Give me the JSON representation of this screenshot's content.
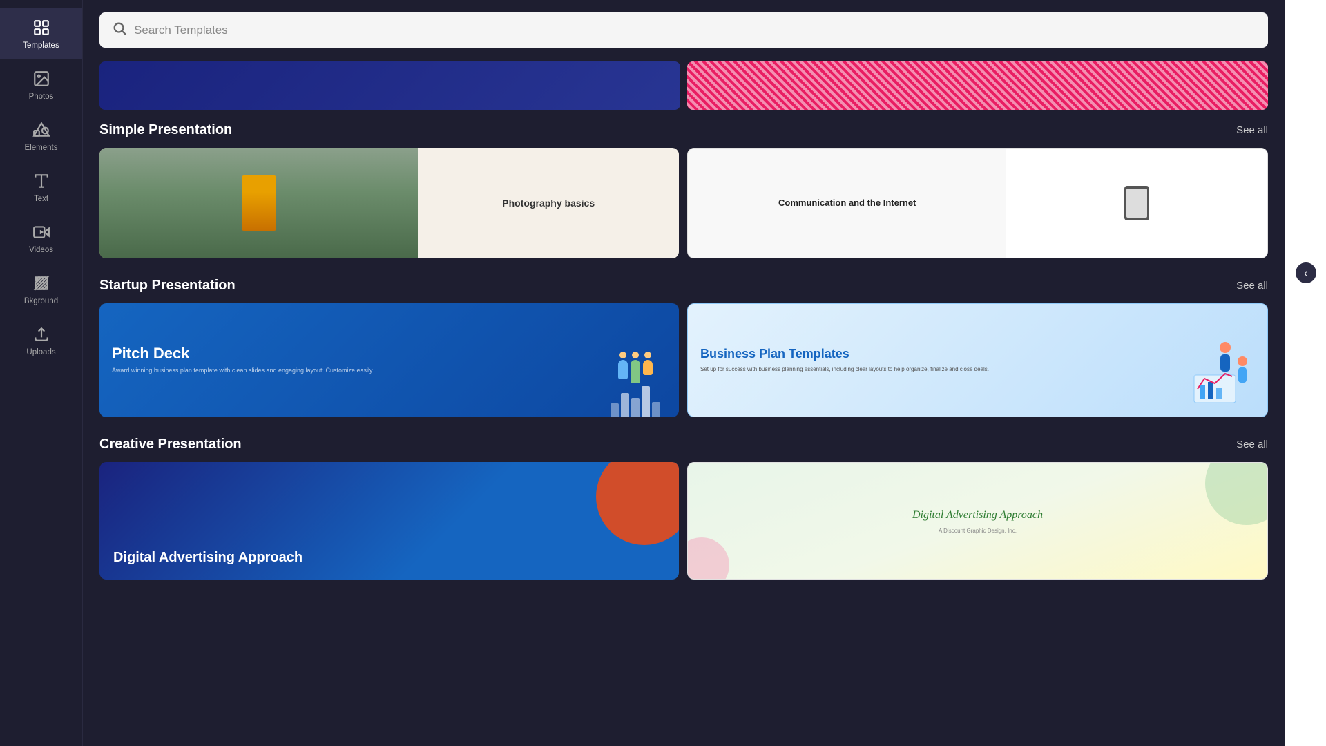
{
  "sidebar": {
    "items": [
      {
        "id": "templates",
        "label": "Templates",
        "icon": "grid-icon",
        "active": true
      },
      {
        "id": "photos",
        "label": "Photos",
        "icon": "photo-icon",
        "active": false
      },
      {
        "id": "elements",
        "label": "Elements",
        "icon": "shapes-icon",
        "active": false
      },
      {
        "id": "text",
        "label": "Text",
        "icon": "text-icon",
        "active": false
      },
      {
        "id": "videos",
        "label": "Videos",
        "icon": "video-icon",
        "active": false
      },
      {
        "id": "background",
        "label": "Bkground",
        "icon": "background-icon",
        "active": false
      },
      {
        "id": "uploads",
        "label": "Uploads",
        "icon": "upload-icon",
        "active": false
      }
    ]
  },
  "search": {
    "placeholder": "Search Templates",
    "value": ""
  },
  "sections": [
    {
      "id": "simple-presentation",
      "title": "Simple Presentation",
      "see_all_label": "See all",
      "cards": [
        {
          "id": "photography-basics",
          "title": "Photography basics"
        },
        {
          "id": "communication-internet",
          "title": "Communication and the Internet"
        }
      ]
    },
    {
      "id": "startup-presentation",
      "title": "Startup Presentation",
      "see_all_label": "See all",
      "cards": [
        {
          "id": "pitch-deck",
          "title": "Pitch Deck"
        },
        {
          "id": "business-plan-templates",
          "title": "Business Plan Templates"
        }
      ]
    },
    {
      "id": "creative-presentation",
      "title": "Creative Presentation",
      "see_all_label": "See all",
      "cards": [
        {
          "id": "digital-advertising-blue",
          "title": "Digital Advertising Approach"
        },
        {
          "id": "digital-advertising-light",
          "title": "Digital Advertising Approach"
        }
      ]
    }
  ],
  "chevron": {
    "label": "<"
  }
}
